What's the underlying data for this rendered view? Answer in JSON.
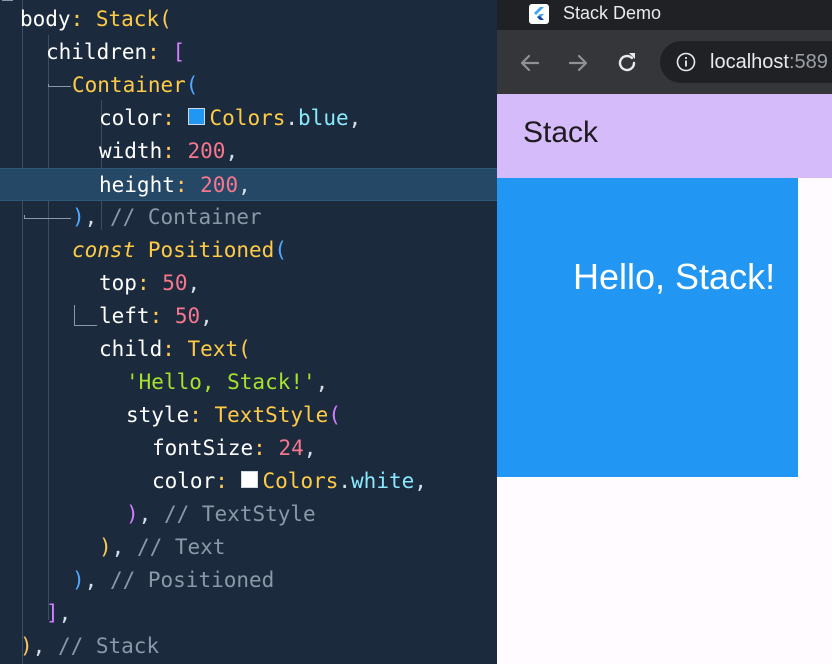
{
  "editor": {
    "lines": [
      [
        [
          "tok-name",
          "body"
        ],
        [
          "tok-punct",
          ": "
        ],
        [
          "tok-class",
          "Stack"
        ],
        [
          "tok-punct",
          "("
        ]
      ],
      [
        [
          "tok-prop",
          "children"
        ],
        [
          "tok-punct",
          ": "
        ],
        [
          "tok-paren-p",
          "["
        ]
      ],
      [
        [
          "tok-class",
          "Container"
        ],
        [
          "tok-paren-b",
          "("
        ]
      ],
      [
        [
          "tok-prop",
          "color"
        ],
        [
          "tok-punct",
          ": "
        ],
        [
          "swatch",
          "#2196f3"
        ],
        [
          "tok-class",
          "Colors"
        ],
        [
          "tok-plain",
          "."
        ],
        [
          "tok-ident",
          "blue"
        ],
        [
          "tok-plain",
          ","
        ]
      ],
      [
        [
          "tok-prop",
          "width"
        ],
        [
          "tok-punct",
          ": "
        ],
        [
          "tok-num",
          "200"
        ],
        [
          "tok-plain",
          ","
        ]
      ],
      [
        [
          "tok-prop",
          "height"
        ],
        [
          "tok-punct",
          ": "
        ],
        [
          "tok-num",
          "200"
        ],
        [
          "tok-plain",
          ","
        ]
      ],
      [
        [
          "tok-paren-b",
          ")"
        ],
        [
          "tok-plain",
          ", "
        ],
        [
          "tok-cmt",
          "// Container"
        ]
      ],
      [
        [
          "tok-kw",
          "const"
        ],
        [
          "tok-plain",
          " "
        ],
        [
          "tok-class",
          "Positioned"
        ],
        [
          "tok-paren-b",
          "("
        ]
      ],
      [
        [
          "tok-prop",
          "top"
        ],
        [
          "tok-punct",
          ": "
        ],
        [
          "tok-num",
          "50"
        ],
        [
          "tok-plain",
          ","
        ]
      ],
      [
        [
          "tok-prop",
          "left"
        ],
        [
          "tok-punct",
          ": "
        ],
        [
          "tok-num",
          "50"
        ],
        [
          "tok-plain",
          ","
        ]
      ],
      [
        [
          "tok-prop",
          "child"
        ],
        [
          "tok-punct",
          ": "
        ],
        [
          "tok-class",
          "Text"
        ],
        [
          "tok-punct",
          "("
        ]
      ],
      [
        [
          "tok-str",
          "'Hello, Stack!'"
        ],
        [
          "tok-plain",
          ","
        ]
      ],
      [
        [
          "tok-prop",
          "style"
        ],
        [
          "tok-punct",
          ": "
        ],
        [
          "tok-class",
          "TextStyle"
        ],
        [
          "tok-paren-p",
          "("
        ]
      ],
      [
        [
          "tok-prop",
          "fontSize"
        ],
        [
          "tok-punct",
          ": "
        ],
        [
          "tok-num",
          "24"
        ],
        [
          "tok-plain",
          ","
        ]
      ],
      [
        [
          "tok-prop",
          "color"
        ],
        [
          "tok-punct",
          ": "
        ],
        [
          "swatch",
          "#ffffff"
        ],
        [
          "tok-class",
          "Colors"
        ],
        [
          "tok-plain",
          "."
        ],
        [
          "tok-ident",
          "white"
        ],
        [
          "tok-plain",
          ","
        ]
      ],
      [
        [
          "tok-paren-p",
          ")"
        ],
        [
          "tok-plain",
          ", "
        ],
        [
          "tok-cmt",
          "// TextStyle"
        ]
      ],
      [
        [
          "tok-punct",
          ")"
        ],
        [
          "tok-plain",
          ", "
        ],
        [
          "tok-cmt",
          "// Text"
        ]
      ],
      [
        [
          "tok-paren-b",
          ")"
        ],
        [
          "tok-plain",
          ", "
        ],
        [
          "tok-cmt",
          "// Positioned"
        ]
      ],
      [
        [
          "tok-paren-p",
          "]"
        ],
        [
          "tok-plain",
          ","
        ]
      ],
      [
        [
          "tok-punct",
          ")"
        ],
        [
          "tok-plain",
          ", "
        ],
        [
          "tok-cmt",
          "// Stack"
        ]
      ]
    ]
  },
  "browser": {
    "tab_title": "Stack Demo",
    "tab_icon": "flutter-logo",
    "back_icon": "arrow-left-icon",
    "forward_icon": "arrow-right-icon",
    "reload_icon": "reload-icon",
    "info_icon": "info-icon",
    "url_host": "localhost",
    "url_port": ":589"
  },
  "app": {
    "appbar_title": "Stack",
    "hello_text": "Hello, Stack!",
    "colors": {
      "appbar": "#d5bbf9",
      "container": "#2196f3",
      "background": "#fffbff"
    }
  }
}
